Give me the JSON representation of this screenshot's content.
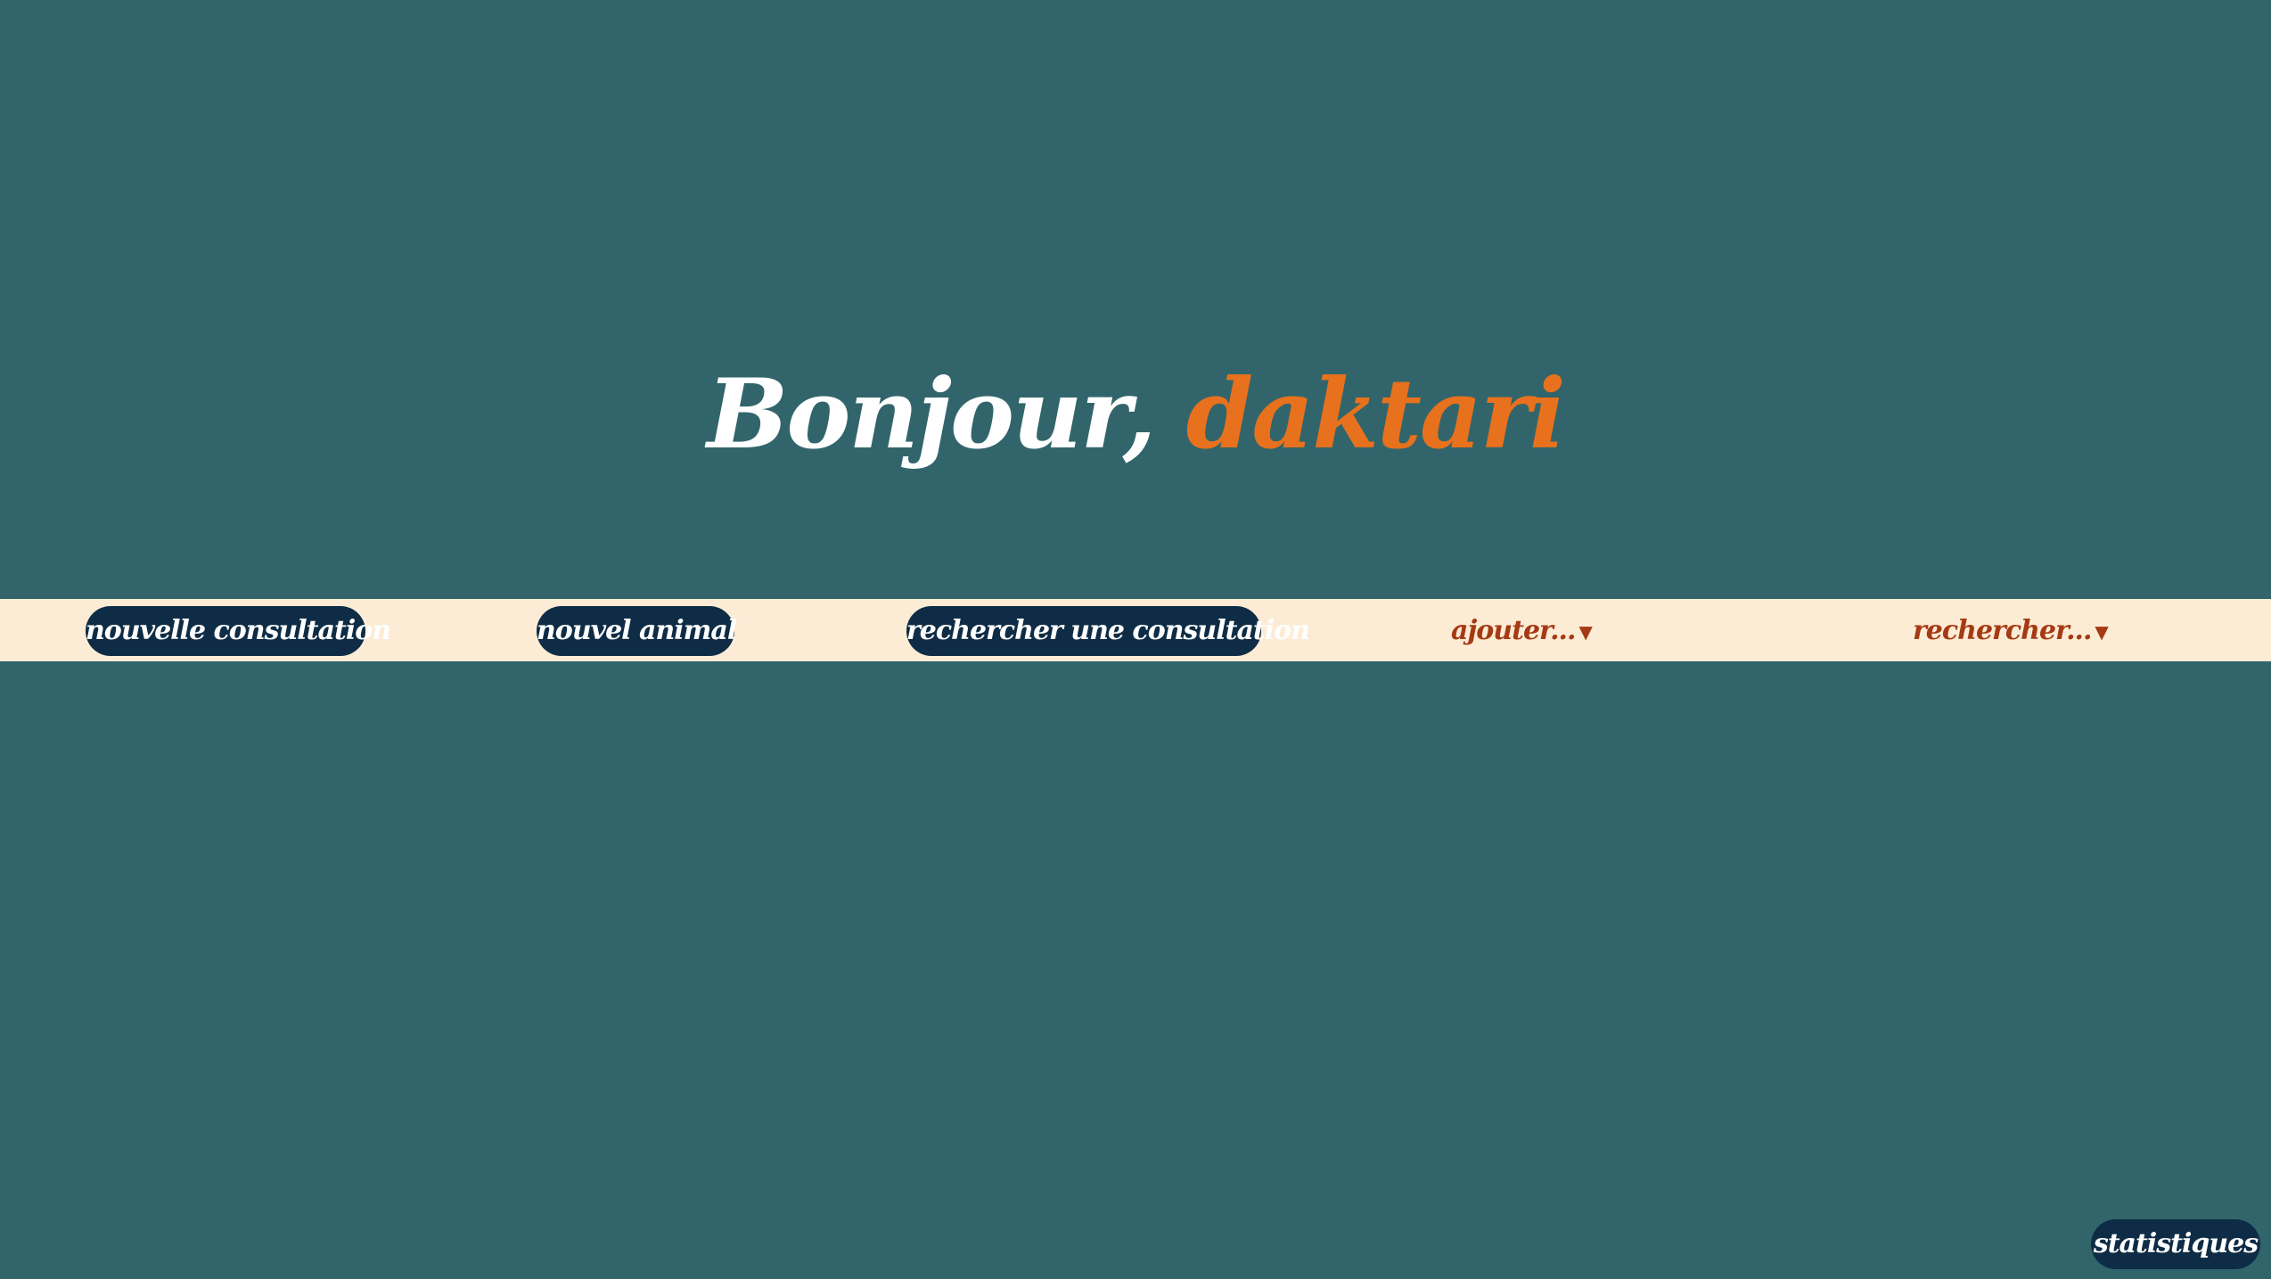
{
  "greeting": {
    "prefix": "Bonjour,",
    "username": "daktari"
  },
  "toolbar": {
    "buttons": [
      {
        "label": "nouvelle consultation"
      },
      {
        "label": "nouvel animal"
      },
      {
        "label": "rechercher une consultation"
      }
    ],
    "dropdowns": [
      {
        "label": "ajouter...",
        "icon": "caret-down-icon"
      },
      {
        "label": "rechercher...",
        "icon": "caret-down-icon"
      }
    ]
  },
  "footer": {
    "stats_label": "statistiques"
  },
  "colors": {
    "background": "#31656b",
    "accent": "#e8711d",
    "toolbar_bg": "#fdecd5",
    "button_bg": "#0e2c45",
    "dropdown_text": "#a53a14"
  }
}
